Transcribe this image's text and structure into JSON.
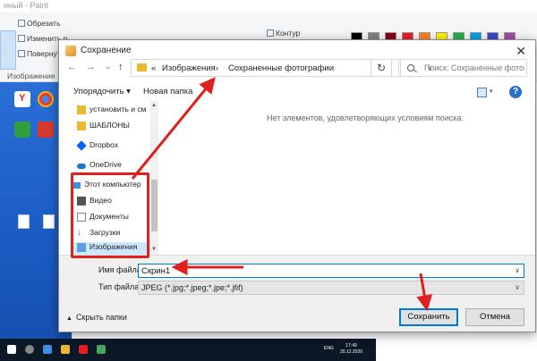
{
  "paint": {
    "title": "нный - Paint",
    "ribbon": {
      "cut": "Обрезать",
      "resize": "Изменить р",
      "rotate": "Повернут",
      "image_group": "Изображение",
      "outline": "Контур"
    },
    "palette": [
      "#000000",
      "#808080",
      "#880015",
      "#ed1c24",
      "#ff7f27",
      "#fff200",
      "#22b14c",
      "#00a2e8",
      "#3f48cc",
      "#a349a4"
    ]
  },
  "taskbar": {
    "lang": "ENG",
    "time": "17:49",
    "date": "20.12.2020"
  },
  "dialog": {
    "title": "Сохранение",
    "close_label": "✕",
    "nav": {
      "back": "←",
      "forward": "→",
      "recent": "⌄",
      "up": "↑"
    },
    "address": {
      "overflow": "«",
      "segment1": "Изображения",
      "separator": "›",
      "segment2": "Сохраненные фотографии"
    },
    "refresh_label": "↻",
    "search_placeholder": "Поиск: Сохраненные фотог...",
    "toolbar": {
      "organize": "Упорядочить ▾",
      "new_folder": "Новая папка",
      "help": "?"
    },
    "sidebar": {
      "items": [
        {
          "label": "установить и см"
        },
        {
          "label": "ШАБЛОНЫ"
        },
        {
          "label": "Dropbox"
        },
        {
          "label": "OneDrive"
        },
        {
          "label": "Этот компьютер"
        },
        {
          "label": "Видео"
        },
        {
          "label": "Документы"
        },
        {
          "label": "Загрузки"
        },
        {
          "label": "Изображения"
        }
      ]
    },
    "empty_message": "Нет элементов, удовлетворяющих условиям поиска.",
    "filename_label": "Имя файла:",
    "filename_value": "Скрин1",
    "filetype_label": "Тип файла:",
    "filetype_value": "JPEG (*.jpg;*.jpeg;*.jpe;*.jfif)",
    "hide_folders": "Скрыть папки",
    "save_label": "Сохранить",
    "cancel_label": "Отмена"
  },
  "annotation_color": "#e0201c"
}
